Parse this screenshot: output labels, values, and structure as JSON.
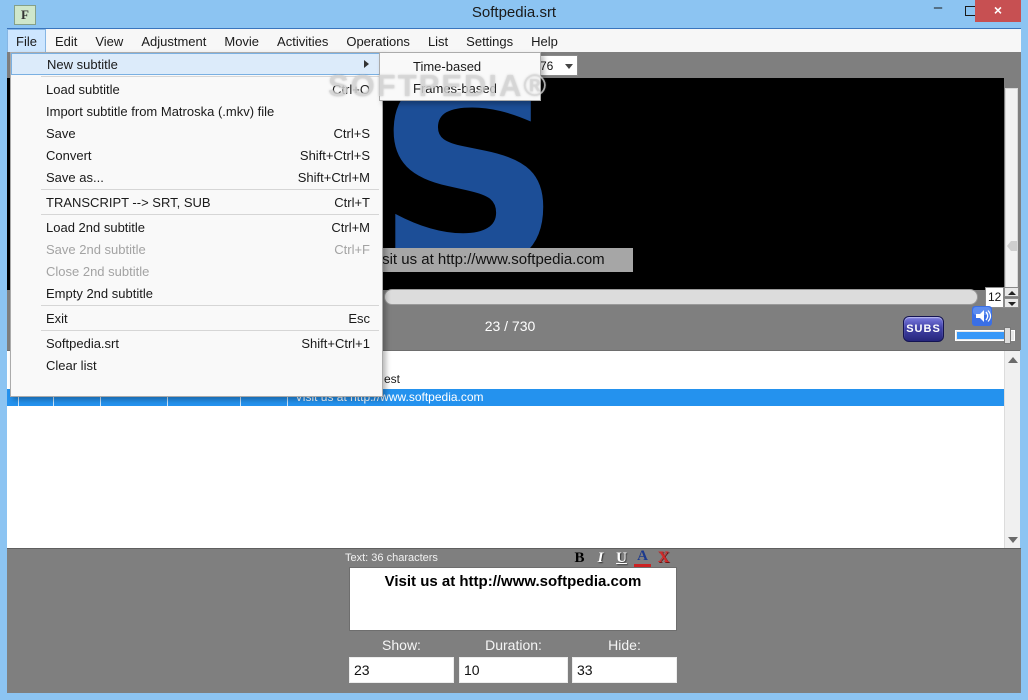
{
  "window": {
    "title": "Softpedia.srt",
    "icon_letter": "F"
  },
  "menubar": {
    "items": [
      "File",
      "Edit",
      "View",
      "Adjustment",
      "Movie",
      "Activities",
      "Operations",
      "List",
      "Settings",
      "Help"
    ],
    "selected": "File"
  },
  "file_menu": {
    "items": [
      {
        "label": "New subtitle",
        "submenu": true,
        "highlighted": true
      },
      {
        "separator": true
      },
      {
        "label": "Load subtitle",
        "shortcut": "Ctrl+O"
      },
      {
        "label": "Import subtitle from Matroska (.mkv) file",
        "shortcut": ""
      },
      {
        "label": "Save",
        "shortcut": "Ctrl+S"
      },
      {
        "label": "Convert",
        "shortcut": "Shift+Ctrl+S"
      },
      {
        "label": "Save as...",
        "shortcut": "Shift+Ctrl+M"
      },
      {
        "separator": true
      },
      {
        "label": "TRANSCRIPT --> SRT, SUB",
        "shortcut": "Ctrl+T"
      },
      {
        "separator": true
      },
      {
        "label": "Load 2nd subtitle",
        "shortcut": "Ctrl+M"
      },
      {
        "label": "Save 2nd subtitle",
        "shortcut": "Ctrl+F",
        "disabled": true
      },
      {
        "label": "Close 2nd subtitle",
        "shortcut": "",
        "disabled": true
      },
      {
        "label": "Empty 2nd subtitle",
        "shortcut": ""
      },
      {
        "separator": true
      },
      {
        "label": "Exit",
        "shortcut": "Esc"
      },
      {
        "separator": true
      },
      {
        "label": "Softpedia.srt",
        "shortcut": "Shift+Ctrl+1"
      },
      {
        "label": "Clear list",
        "shortcut": ""
      }
    ]
  },
  "new_subtitle_submenu": {
    "items": [
      "Time-based",
      "Frames-based"
    ]
  },
  "toolbar": {
    "fps_combo_visible_value": "76"
  },
  "player": {
    "logo_letter": "S",
    "subtitle_overlay": "Visit us at http://www.softpedia.com",
    "counter": "23 / 730",
    "rate_spinner_value": "12",
    "subs_button_label": "SUBS"
  },
  "subtitle_list": {
    "rows": [
      {
        "partial_text": "est",
        "selected": false
      },
      {
        "text": "Visit us at http://www.softpedia.com",
        "selected": true
      }
    ]
  },
  "editor": {
    "char_count_label": "Text: 36 characters",
    "format_buttons": [
      {
        "glyph": "B",
        "name": "bold"
      },
      {
        "glyph": "I",
        "name": "italic"
      },
      {
        "glyph": "U",
        "name": "underline"
      },
      {
        "glyph": "A",
        "name": "font-color"
      },
      {
        "glyph": "X",
        "name": "remove-formatting"
      }
    ],
    "text": "Visit us at http://www.softpedia.com",
    "show_label": "Show:",
    "duration_label": "Duration:",
    "hide_label": "Hide:",
    "show_value": "23",
    "duration_value": "10",
    "hide_value": "33"
  },
  "watermark_text": "SOFTPEDIA®",
  "colors": {
    "titlebar": "#8cc4f2",
    "close_button": "#c75052",
    "selection_blue": "#2492ee",
    "logo_blue": "#1c4e97",
    "panel_gray": "#7f7f7f",
    "menu_highlight": "#dcebfa"
  }
}
